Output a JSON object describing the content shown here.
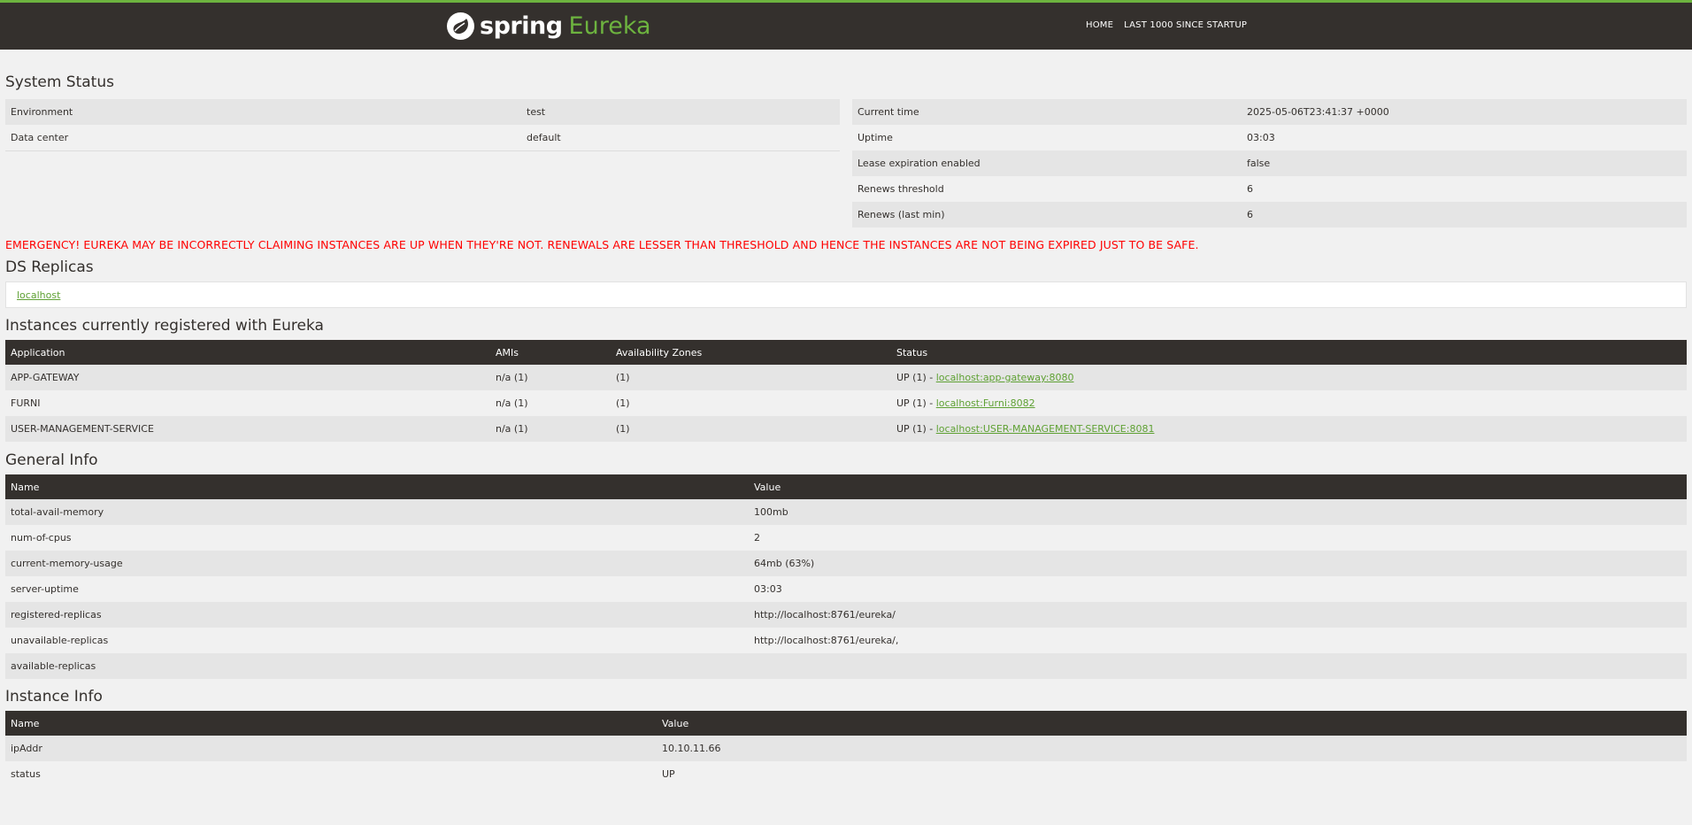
{
  "nav": {
    "brand_spring": "spring",
    "brand_eureka": "Eureka",
    "links": [
      "HOME",
      "LAST 1000 SINCE STARTUP"
    ]
  },
  "system_status": {
    "title": "System Status",
    "left": [
      {
        "label": "Environment",
        "value": "test"
      },
      {
        "label": "Data center",
        "value": "default"
      }
    ],
    "right": [
      {
        "label": "Current time",
        "value": "2025-05-06T23:41:37 +0000"
      },
      {
        "label": "Uptime",
        "value": "03:03"
      },
      {
        "label": "Lease expiration enabled",
        "value": "false"
      },
      {
        "label": "Renews threshold",
        "value": "6"
      },
      {
        "label": "Renews (last min)",
        "value": "6"
      }
    ]
  },
  "emergency": "EMERGENCY! EUREKA MAY BE INCORRECTLY CLAIMING INSTANCES ARE UP WHEN THEY'RE NOT. RENEWALS ARE LESSER THAN THRESHOLD AND HENCE THE INSTANCES ARE NOT BEING EXPIRED JUST TO BE SAFE.",
  "ds_replicas": {
    "title": "DS Replicas",
    "link": "localhost"
  },
  "instances": {
    "title": "Instances currently registered with Eureka",
    "headers": [
      "Application",
      "AMIs",
      "Availability Zones",
      "Status"
    ],
    "rows": [
      {
        "app": "APP-GATEWAY",
        "amis": "n/a (1)",
        "zones": "(1)",
        "status_prefix": "UP (1) - ",
        "link": "localhost:app-gateway:8080"
      },
      {
        "app": "FURNI",
        "amis": "n/a (1)",
        "zones": "(1)",
        "status_prefix": "UP (1) - ",
        "link": "localhost:Furni:8082"
      },
      {
        "app": "USER-MANAGEMENT-SERVICE",
        "amis": "n/a (1)",
        "zones": "(1)",
        "status_prefix": "UP (1) - ",
        "link": "localhost:USER-MANAGEMENT-SERVICE:8081"
      }
    ]
  },
  "general_info": {
    "title": "General Info",
    "headers": [
      "Name",
      "Value"
    ],
    "rows": [
      {
        "name": "total-avail-memory",
        "value": "100mb"
      },
      {
        "name": "num-of-cpus",
        "value": "2"
      },
      {
        "name": "current-memory-usage",
        "value": "64mb (63%)"
      },
      {
        "name": "server-uptime",
        "value": "03:03"
      },
      {
        "name": "registered-replicas",
        "value": "http://localhost:8761/eureka/"
      },
      {
        "name": "unavailable-replicas",
        "value": "http://localhost:8761/eureka/,"
      },
      {
        "name": "available-replicas",
        "value": ""
      }
    ]
  },
  "instance_info": {
    "title": "Instance Info",
    "headers": [
      "Name",
      "Value"
    ],
    "rows": [
      {
        "name": "ipAddr",
        "value": "10.10.11.66"
      },
      {
        "name": "status",
        "value": "UP"
      }
    ]
  },
  "colors": {
    "nav_bg": "#34302d",
    "accent": "#6db33f",
    "emergency": "#ff0000",
    "link": "#5fa134"
  }
}
